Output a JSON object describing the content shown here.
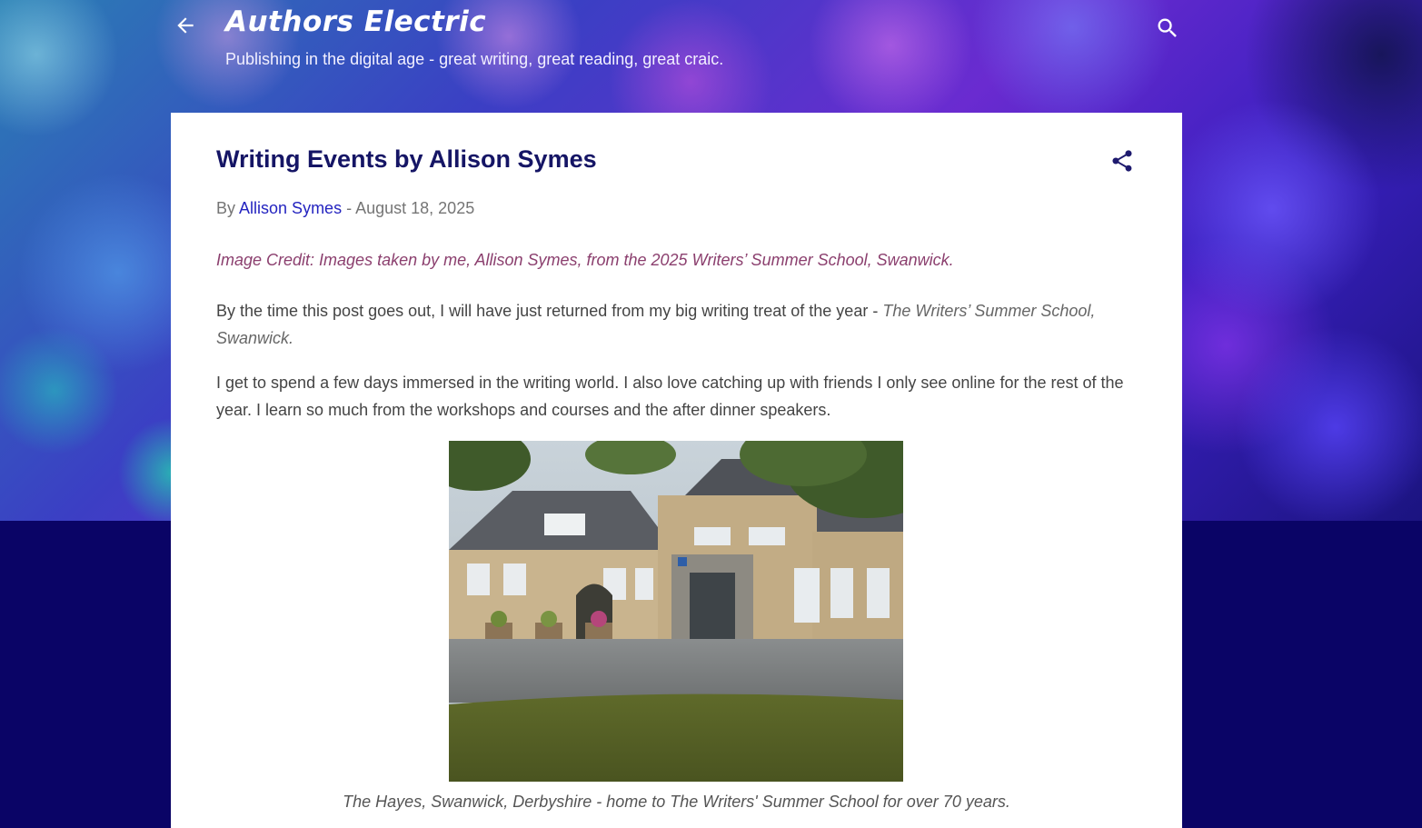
{
  "blog": {
    "title": "Authors Electric",
    "tagline": "Publishing in the digital age - great writing, great reading, great craic."
  },
  "icons": {
    "back": "arrow-back-icon",
    "search": "search-icon",
    "share": "share-icon"
  },
  "post": {
    "title": "Writing Events by Allison Symes",
    "byline_prefix": "By",
    "author": "Allison Symes",
    "separator": "-",
    "date": "August 18, 2025",
    "image_credit": "Image Credit:  Images taken by me, Allison Symes, from the 2025 Writers’ Summer School, Swanwick.",
    "paragraph_1_text": "By the time this post goes out, I will have just returned from my big writing treat of the year - ",
    "paragraph_1_italic": "The Writers’ Summer School, Swanwick.",
    "paragraph_2_text": "I get to spend a few days immersed in the writing world. I also love catching up with friends I only see online for the rest of the year. I learn so much from the workshops and courses and the after dinner speakers.",
    "image_caption": "The Hayes, Swanwick, Derbyshire - home to The Writers' Summer School for over 70 years."
  },
  "colors": {
    "page_background": "#0a0466",
    "title_color": "#151565",
    "author_link": "#2424c0",
    "credit_text": "#8b3f6e"
  }
}
